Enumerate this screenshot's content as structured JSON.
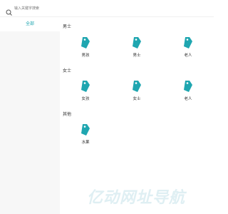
{
  "search": {
    "placeholder": "输入关键字搜索"
  },
  "sidebar": {
    "items": [
      {
        "label": "全部",
        "active": true
      }
    ]
  },
  "sections": [
    {
      "title": "男士",
      "items": [
        {
          "label": "男孩"
        },
        {
          "label": "男士"
        },
        {
          "label": "老人"
        }
      ]
    },
    {
      "title": "女士",
      "items": [
        {
          "label": "女孩"
        },
        {
          "label": "女士"
        },
        {
          "label": "老人"
        }
      ]
    },
    {
      "title": "其他",
      "items": [
        {
          "label": "水果"
        }
      ]
    }
  ],
  "watermark": {
    "text": "亿动网址导航"
  },
  "colors": {
    "accent": "#1fa6b0",
    "sidebar_bg": "#f7f7f7",
    "watermark": "#dfeff3"
  }
}
